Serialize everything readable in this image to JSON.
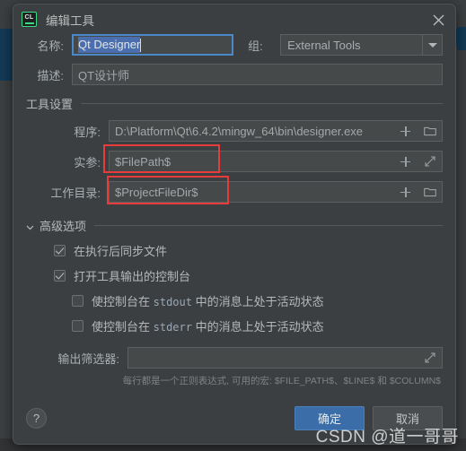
{
  "window": {
    "app_icon": "clion-icon",
    "title": "编辑工具",
    "close_icon": "close-icon"
  },
  "form": {
    "name_label": "名称:",
    "name_value": "Qt Designer",
    "group_label": "组:",
    "group_value": "External Tools",
    "group_dropdown_icon": "chevron-down-icon",
    "description_label": "描述:",
    "description_value": "QT设计师"
  },
  "tool_settings": {
    "section_title": "工具设置",
    "rows": [
      {
        "label": "程序:",
        "value": "D:\\Platform\\Qt\\6.4.2\\mingw_64\\bin\\designer.exe",
        "add_icon": "plus-icon",
        "browse_icon": "folder-icon",
        "highlighted": false
      },
      {
        "label": "实参:",
        "value": "$FilePath$",
        "add_icon": "plus-icon",
        "browse_icon": "expand-icon",
        "highlighted": true
      },
      {
        "label": "工作目录:",
        "value": "$ProjectFileDir$",
        "add_icon": "plus-icon",
        "browse_icon": "folder-icon",
        "highlighted": true
      }
    ]
  },
  "advanced": {
    "section_title": "高级选项",
    "collapse_icon": "chevron-down-icon",
    "checkboxes": [
      {
        "label": "在执行后同步文件",
        "checked": true,
        "indent": false,
        "mono": ""
      },
      {
        "label": "打开工具输出的控制台",
        "checked": true,
        "indent": false,
        "mono": ""
      },
      {
        "label_pre": "使控制台在 ",
        "mono": "stdout",
        "label_post": " 中的消息上处于活动状态",
        "checked": false,
        "indent": true
      },
      {
        "label_pre": "使控制台在 ",
        "mono": "stderr",
        "label_post": " 中的消息上处于活动状态",
        "checked": false,
        "indent": true
      }
    ],
    "filter_label": "输出筛选器:",
    "filter_value": "",
    "filter_expand_icon": "expand-icon",
    "hint": "每行都是一个正则表达式, 可用的宏: $FILE_PATH$、$LINE$ 和 $COLUMN$"
  },
  "footer": {
    "help_label": "?",
    "help_icon": "question-icon",
    "ok_label": "确定",
    "cancel_label": "取消"
  },
  "watermark": {
    "text": "CSDN @道一哥哥"
  },
  "colors": {
    "dialog_bg": "#3c3f41",
    "field_bg": "#45494a",
    "accent_blue": "#3b6ea8",
    "focus_blue": "#4a88c7",
    "selection_blue": "#4b6eaf",
    "annotation_red": "#e83c3c",
    "icon_green": "#3ddc84"
  }
}
